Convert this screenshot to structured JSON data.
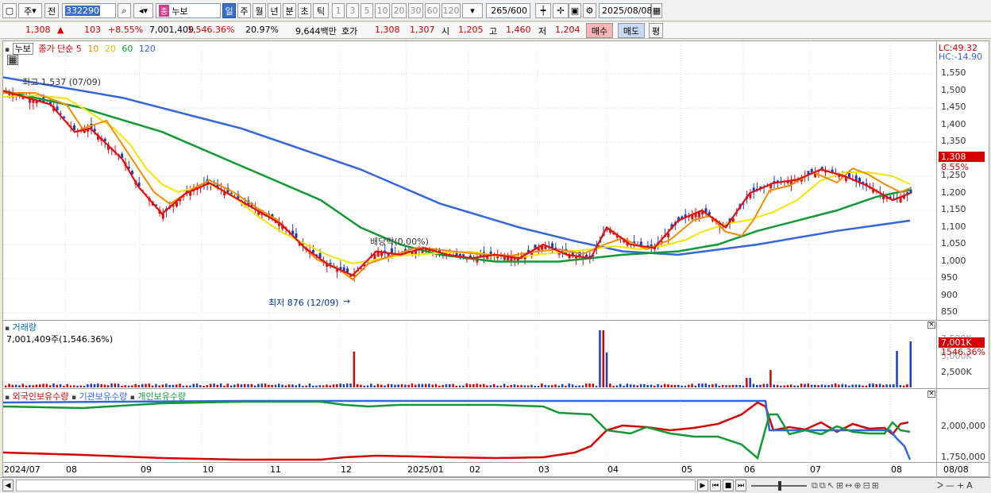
{
  "toolbar": {
    "market": "주",
    "prev": "전",
    "code": "332290",
    "name_icon": "종",
    "name": "누보",
    "periods": [
      "일",
      "주",
      "월",
      "년",
      "분",
      "초",
      "틱"
    ],
    "minutes": [
      "1",
      "3",
      "5",
      "10",
      "20",
      "30",
      "60",
      "120"
    ],
    "count": "265",
    "count_total": "/600",
    "date": "2025/08/08"
  },
  "quote": {
    "price": "1,308",
    "arrow": "▲",
    "change": "103",
    "change_pct": "+8.55%",
    "volume": "7,001,409",
    "volume_pct": "1,546.36%",
    "turnover": "20.97%",
    "amount": "9,644백만",
    "ask_label": "호가",
    "ask": "1,308",
    "bid": "1,307",
    "open_label": "시",
    "open": "1,205",
    "high_label": "고",
    "high": "1,460",
    "low_label": "저",
    "low": "1,204",
    "buy": "매수",
    "sell": "매도",
    "avg": "평"
  },
  "price_pane": {
    "title": "누보",
    "legend_prefix": "종가 단순",
    "ma": [
      {
        "period": "5",
        "color": "#e01010"
      },
      {
        "period": "10",
        "color": "#f08c00"
      },
      {
        "period": "20",
        "color": "#f4e400"
      },
      {
        "period": "60",
        "color": "#119933"
      },
      {
        "period": "120",
        "color": "#3366dd"
      }
    ],
    "high_annot": "최고 1,537 (07/09)",
    "low_annot": "최저 876 (12/09)",
    "dividend_annot": "배당락(0.00%)",
    "lc": "LC:49.32",
    "hc": "HC:-14.90",
    "ticks": [
      "1,550",
      "1,500",
      "1,450",
      "1,400",
      "1,350",
      "1,300",
      "1,250",
      "1,200",
      "1,150",
      "1,100",
      "1,050",
      "1,000",
      "950",
      "900",
      "850"
    ],
    "cur_price": "1,308",
    "cur_pct": "8.55%"
  },
  "volume_pane": {
    "title": "거래량",
    "value": "7,001,409주(1,546.36%)",
    "tag": "7,001K",
    "tag_pct": "1546.36%",
    "ticks": [
      "7,500K",
      "5,000K",
      "2,500K"
    ]
  },
  "holdings_pane": {
    "legend": [
      {
        "name": "외국인보유수량",
        "color": "#d40000"
      },
      {
        "name": "기관보유수량",
        "color": "#3366dd"
      },
      {
        "name": "개인보유수량",
        "color": "#119933"
      }
    ],
    "ticks": [
      "2,000,000",
      "1,750,000"
    ]
  },
  "x_axis": {
    "labels": [
      "2024/07",
      "08",
      "09",
      "10",
      "11",
      "12",
      "2025/01",
      "02",
      "03",
      "04",
      "05",
      "06",
      "07",
      "08"
    ],
    "last_date": "08/08"
  },
  "chart_data": {
    "type": "line",
    "series": [
      {
        "name": "5",
        "points": [
          [
            0,
            1500
          ],
          [
            30,
            1480
          ],
          [
            60,
            1460
          ],
          [
            90,
            1380
          ],
          [
            110,
            1390
          ],
          [
            150,
            1300
          ],
          [
            170,
            1220
          ],
          [
            200,
            1140
          ],
          [
            230,
            1200
          ],
          [
            260,
            1230
          ],
          [
            290,
            1190
          ],
          [
            320,
            1150
          ],
          [
            350,
            1110
          ],
          [
            380,
            1040
          ],
          [
            410,
            990
          ],
          [
            440,
            960
          ],
          [
            470,
            1030
          ],
          [
            500,
            1020
          ],
          [
            530,
            1040
          ],
          [
            560,
            1020
          ],
          [
            590,
            1010
          ],
          [
            620,
            1020
          ],
          [
            650,
            1010
          ],
          [
            680,
            1050
          ],
          [
            710,
            1020
          ],
          [
            740,
            1010
          ],
          [
            760,
            1100
          ],
          [
            790,
            1050
          ],
          [
            820,
            1040
          ],
          [
            850,
            1120
          ],
          [
            880,
            1150
          ],
          [
            910,
            1100
          ],
          [
            940,
            1200
          ],
          [
            970,
            1230
          ],
          [
            1000,
            1240
          ],
          [
            1030,
            1270
          ],
          [
            1060,
            1250
          ],
          [
            1090,
            1220
          ],
          [
            1120,
            1180
          ],
          [
            1142,
            1200
          ]
        ]
      },
      {
        "name": "60",
        "points": [
          [
            0,
            1500
          ],
          [
            100,
            1450
          ],
          [
            200,
            1380
          ],
          [
            300,
            1280
          ],
          [
            400,
            1180
          ],
          [
            450,
            1100
          ],
          [
            500,
            1050
          ],
          [
            550,
            1020
          ],
          [
            620,
            1000
          ],
          [
            700,
            1000
          ],
          [
            780,
            1020
          ],
          [
            850,
            1030
          ],
          [
            900,
            1050
          ],
          [
            950,
            1090
          ],
          [
            1000,
            1120
          ],
          [
            1050,
            1150
          ],
          [
            1100,
            1190
          ],
          [
            1142,
            1210
          ]
        ]
      },
      {
        "name": "120",
        "points": [
          [
            0,
            1540
          ],
          [
            150,
            1480
          ],
          [
            300,
            1390
          ],
          [
            450,
            1270
          ],
          [
            550,
            1170
          ],
          [
            650,
            1100
          ],
          [
            720,
            1060
          ],
          [
            780,
            1030
          ],
          [
            850,
            1020
          ],
          [
            950,
            1050
          ],
          [
            1050,
            1090
          ],
          [
            1142,
            1120
          ]
        ]
      }
    ],
    "ylim": [
      850,
      1550
    ]
  }
}
